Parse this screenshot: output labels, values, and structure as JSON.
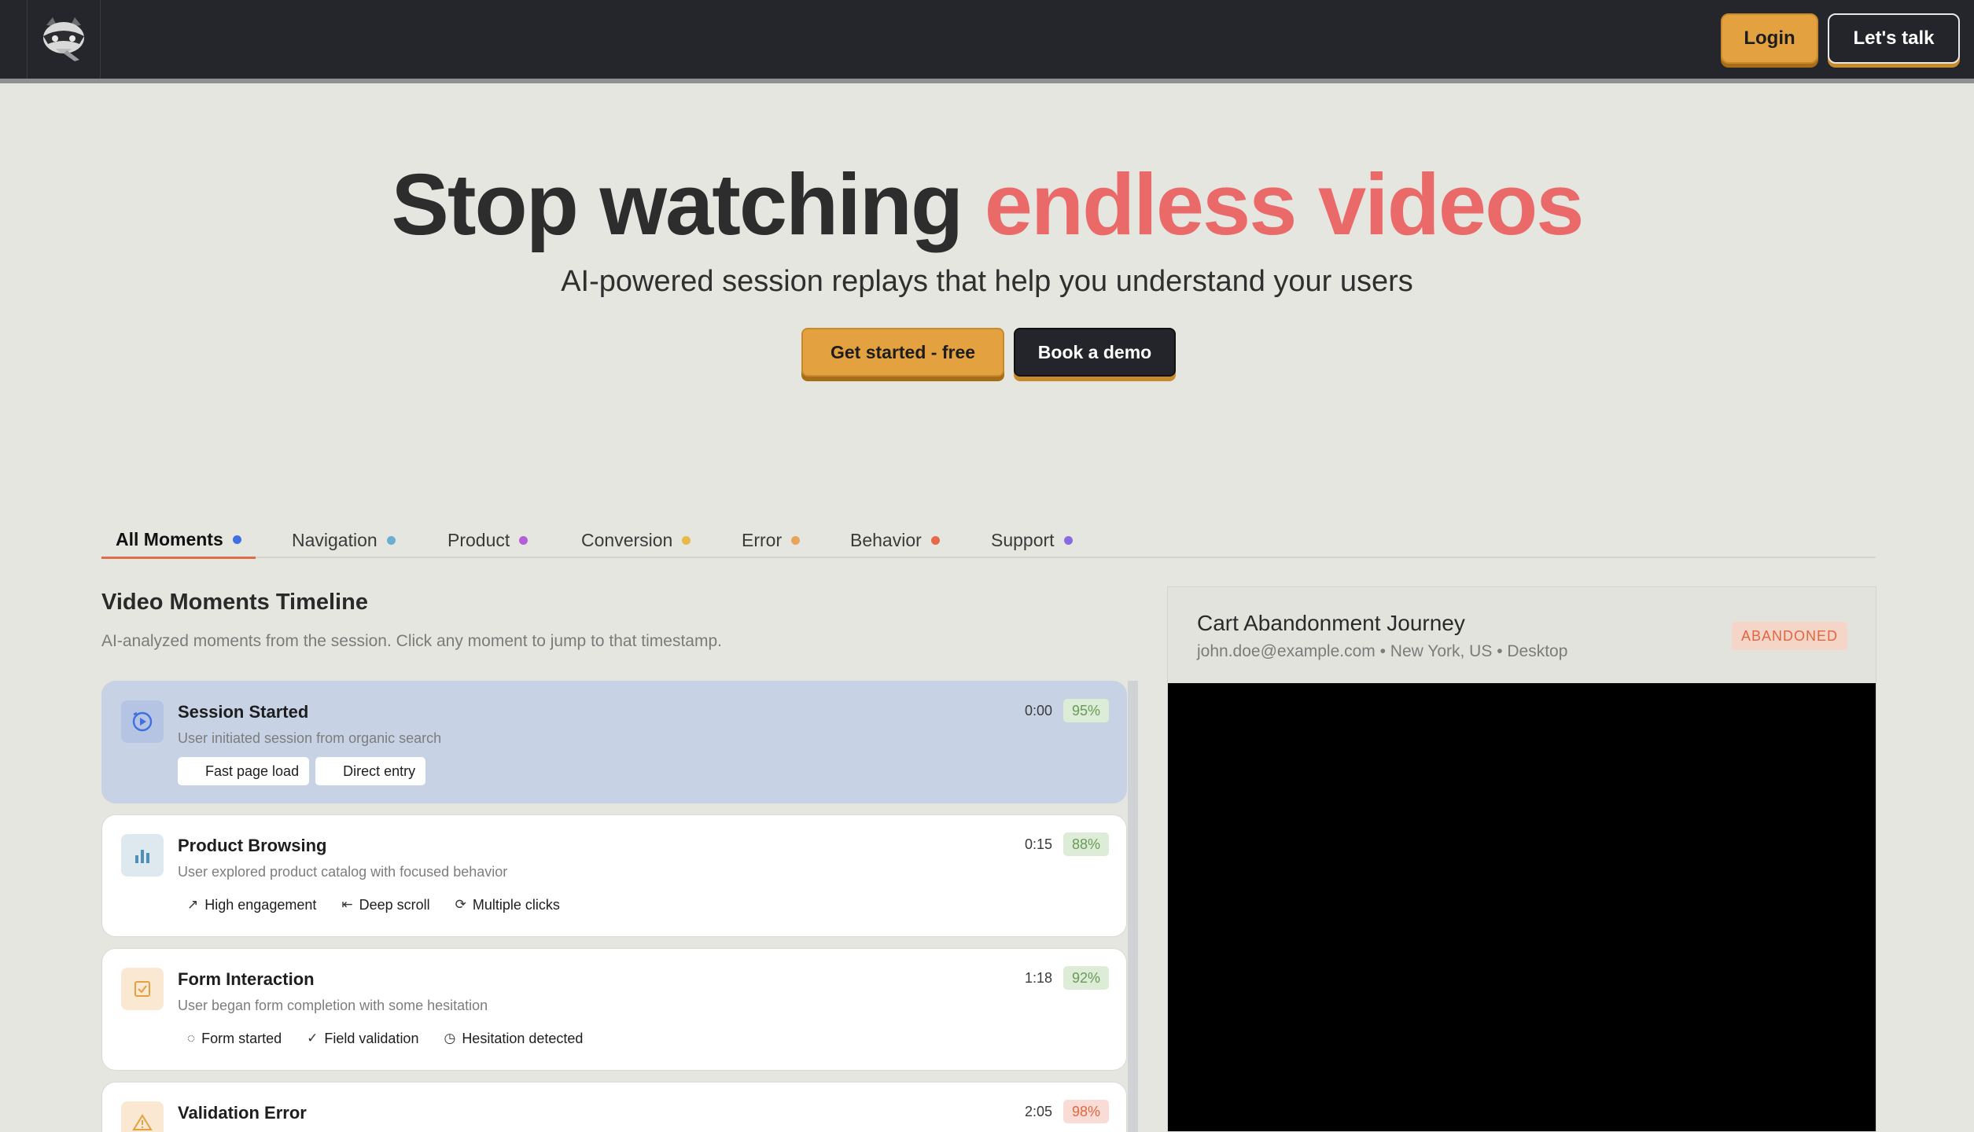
{
  "nav": {
    "login_label": "Login",
    "talk_label": "Let's talk"
  },
  "hero": {
    "title_main": "Stop watching ",
    "title_accent": "endless videos",
    "subtitle": "AI-powered session replays that help you understand your users",
    "primary_cta": "Get started - free",
    "secondary_cta": "Book a demo"
  },
  "colors": {
    "accent": "#e3a23f",
    "headline_accent": "#ea6a6a",
    "dark": "#25262b"
  },
  "tabs": [
    {
      "label": "All Moments",
      "dot": "#3f6fe0"
    },
    {
      "label": "Navigation",
      "dot": "#6aaed0"
    },
    {
      "label": "Product",
      "dot": "#b45fd8"
    },
    {
      "label": "Conversion",
      "dot": "#e7b84a"
    },
    {
      "label": "Error",
      "dot": "#e9a45c"
    },
    {
      "label": "Behavior",
      "dot": "#e46a4a"
    },
    {
      "label": "Support",
      "dot": "#8a6ae0"
    }
  ],
  "timeline": {
    "title": "Video Moments Timeline",
    "description": "AI-analyzed moments from the session. Click any moment to jump to that timestamp.",
    "moments": [
      {
        "title": "Session Started",
        "subtitle": "User initiated session from organic search",
        "time": "0:00",
        "confidence": "95%",
        "icon": "play-circle-icon",
        "tags": [
          "Fast page load",
          "Direct entry"
        ]
      },
      {
        "title": "Product Browsing",
        "subtitle": "User explored product catalog with focused behavior",
        "time": "0:15",
        "confidence": "88%",
        "icon": "bar-chart-icon",
        "tags": [
          "High engagement",
          "Deep scroll",
          "Multiple clicks"
        ]
      },
      {
        "title": "Form Interaction",
        "subtitle": "User began form completion with some hesitation",
        "time": "1:18",
        "confidence": "92%",
        "icon": "checkbox-icon",
        "tags": [
          "Form started",
          "Field validation",
          "Hesitation detected"
        ]
      },
      {
        "title": "Validation Error",
        "time": "2:05",
        "confidence": "98%",
        "icon": "warning-icon"
      }
    ]
  },
  "session": {
    "title": "Cart Abandonment Journey",
    "meta": "john.doe@example.com • New York, US • Desktop",
    "status": "ABANDONED"
  }
}
